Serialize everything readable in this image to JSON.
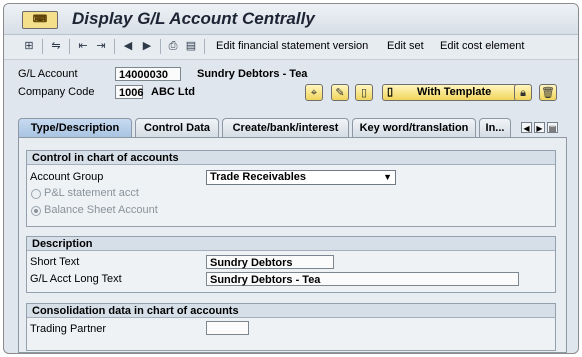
{
  "title": "Display G/L Account Centrally",
  "title_icon": "sap-transaction-icon",
  "toolbar": {
    "edit_fs_version": "Edit financial statement version",
    "edit_set": "Edit set",
    "edit_cost_element": "Edit cost element"
  },
  "header": {
    "gl_account_label": "G/L Account",
    "gl_account_value": "14000030",
    "gl_account_desc": "Sundry Debtors - Tea",
    "company_code_label": "Company Code",
    "company_code_value": "1006",
    "company_code_desc": "ABC Ltd",
    "with_template_label": "With Template"
  },
  "tabs": [
    {
      "label": "Type/Description",
      "active": true
    },
    {
      "label": "Control Data",
      "active": false
    },
    {
      "label": "Create/bank/interest",
      "active": false
    },
    {
      "label": "Key word/translation",
      "active": false
    },
    {
      "label": "In...",
      "active": false
    }
  ],
  "control_group": {
    "heading": "Control in chart of accounts",
    "account_group_label": "Account Group",
    "account_group_value": "Trade Receivables",
    "radio_pl": "P&L statement acct",
    "radio_bs": "Balance Sheet Account",
    "selected": "Balance Sheet Account"
  },
  "description_group": {
    "heading": "Description",
    "short_text_label": "Short Text",
    "short_text_value": "Sundry Debtors",
    "long_text_label": "G/L Acct Long Text",
    "long_text_value": "Sundry Debtors - Tea"
  },
  "consolidation_group": {
    "heading": "Consolidation data in chart of accounts",
    "trading_partner_label": "Trading Partner",
    "trading_partner_value": ""
  },
  "colors": {
    "accent_yellow": "#f1d55a",
    "active_tab": "#a9c4e2",
    "background": "#dfe6ee"
  }
}
